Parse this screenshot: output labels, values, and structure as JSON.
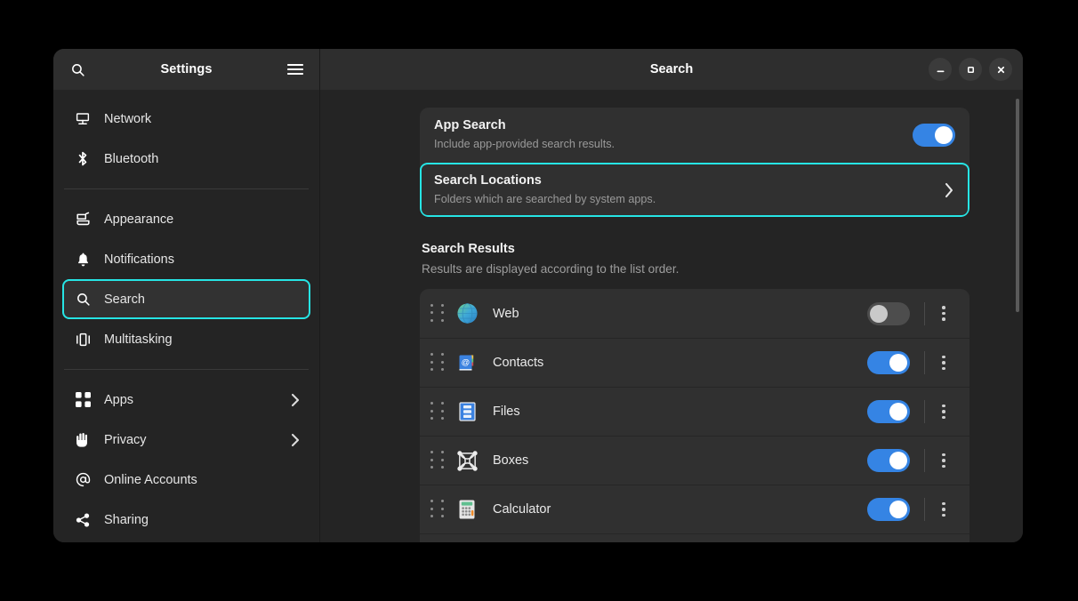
{
  "sidebar": {
    "title": "Settings",
    "search_icon": "search-icon",
    "menu_icon": "hamburger-menu-icon",
    "groups": [
      {
        "items": [
          {
            "label": "Network",
            "icon": "network-icon",
            "chevron": false,
            "selected": false
          },
          {
            "label": "Bluetooth",
            "icon": "bluetooth-icon",
            "chevron": false,
            "selected": false
          }
        ]
      },
      {
        "items": [
          {
            "label": "Appearance",
            "icon": "appearance-icon",
            "chevron": false,
            "selected": false
          },
          {
            "label": "Notifications",
            "icon": "notifications-icon",
            "chevron": false,
            "selected": false
          },
          {
            "label": "Search",
            "icon": "search-icon",
            "chevron": false,
            "selected": true
          },
          {
            "label": "Multitasking",
            "icon": "multitasking-icon",
            "chevron": false,
            "selected": false
          }
        ]
      },
      {
        "items": [
          {
            "label": "Apps",
            "icon": "apps-grid-icon",
            "chevron": true,
            "selected": false
          },
          {
            "label": "Privacy",
            "icon": "privacy-hand-icon",
            "chevron": true,
            "selected": false
          },
          {
            "label": "Online Accounts",
            "icon": "at-sign-icon",
            "chevron": false,
            "selected": false
          },
          {
            "label": "Sharing",
            "icon": "share-nodes-icon",
            "chevron": false,
            "selected": false
          }
        ]
      }
    ]
  },
  "header": {
    "title": "Search",
    "minimize_label": "Minimize",
    "maximize_label": "Maximize",
    "close_label": "Close"
  },
  "main": {
    "top_card": [
      {
        "title": "App Search",
        "subtitle": "Include app-provided search results.",
        "control": "toggle",
        "toggle_on": true,
        "focused": false
      },
      {
        "title": "Search Locations",
        "subtitle": "Folders which are searched by system apps.",
        "control": "chevron",
        "toggle_on": null,
        "focused": true
      }
    ],
    "section": {
      "title": "Search Results",
      "subtitle": "Results are displayed according to the list order."
    },
    "results": [
      {
        "name": "Web",
        "icon": "web-globe-icon",
        "enabled": false
      },
      {
        "name": "Contacts",
        "icon": "contacts-icon",
        "enabled": true
      },
      {
        "name": "Files",
        "icon": "files-icon",
        "enabled": true
      },
      {
        "name": "Boxes",
        "icon": "boxes-icon",
        "enabled": true
      },
      {
        "name": "Calculator",
        "icon": "calculator-icon",
        "enabled": true
      },
      {
        "name": "",
        "icon": "partial-icon",
        "enabled": true
      }
    ],
    "menu_button_label": "More options"
  },
  "colors": {
    "accent_blue": "#3584e4",
    "focus_cyan": "#26e5e5",
    "window_bg": "#242424",
    "header_bg": "#2e2e2e",
    "card_bg": "#303030"
  }
}
